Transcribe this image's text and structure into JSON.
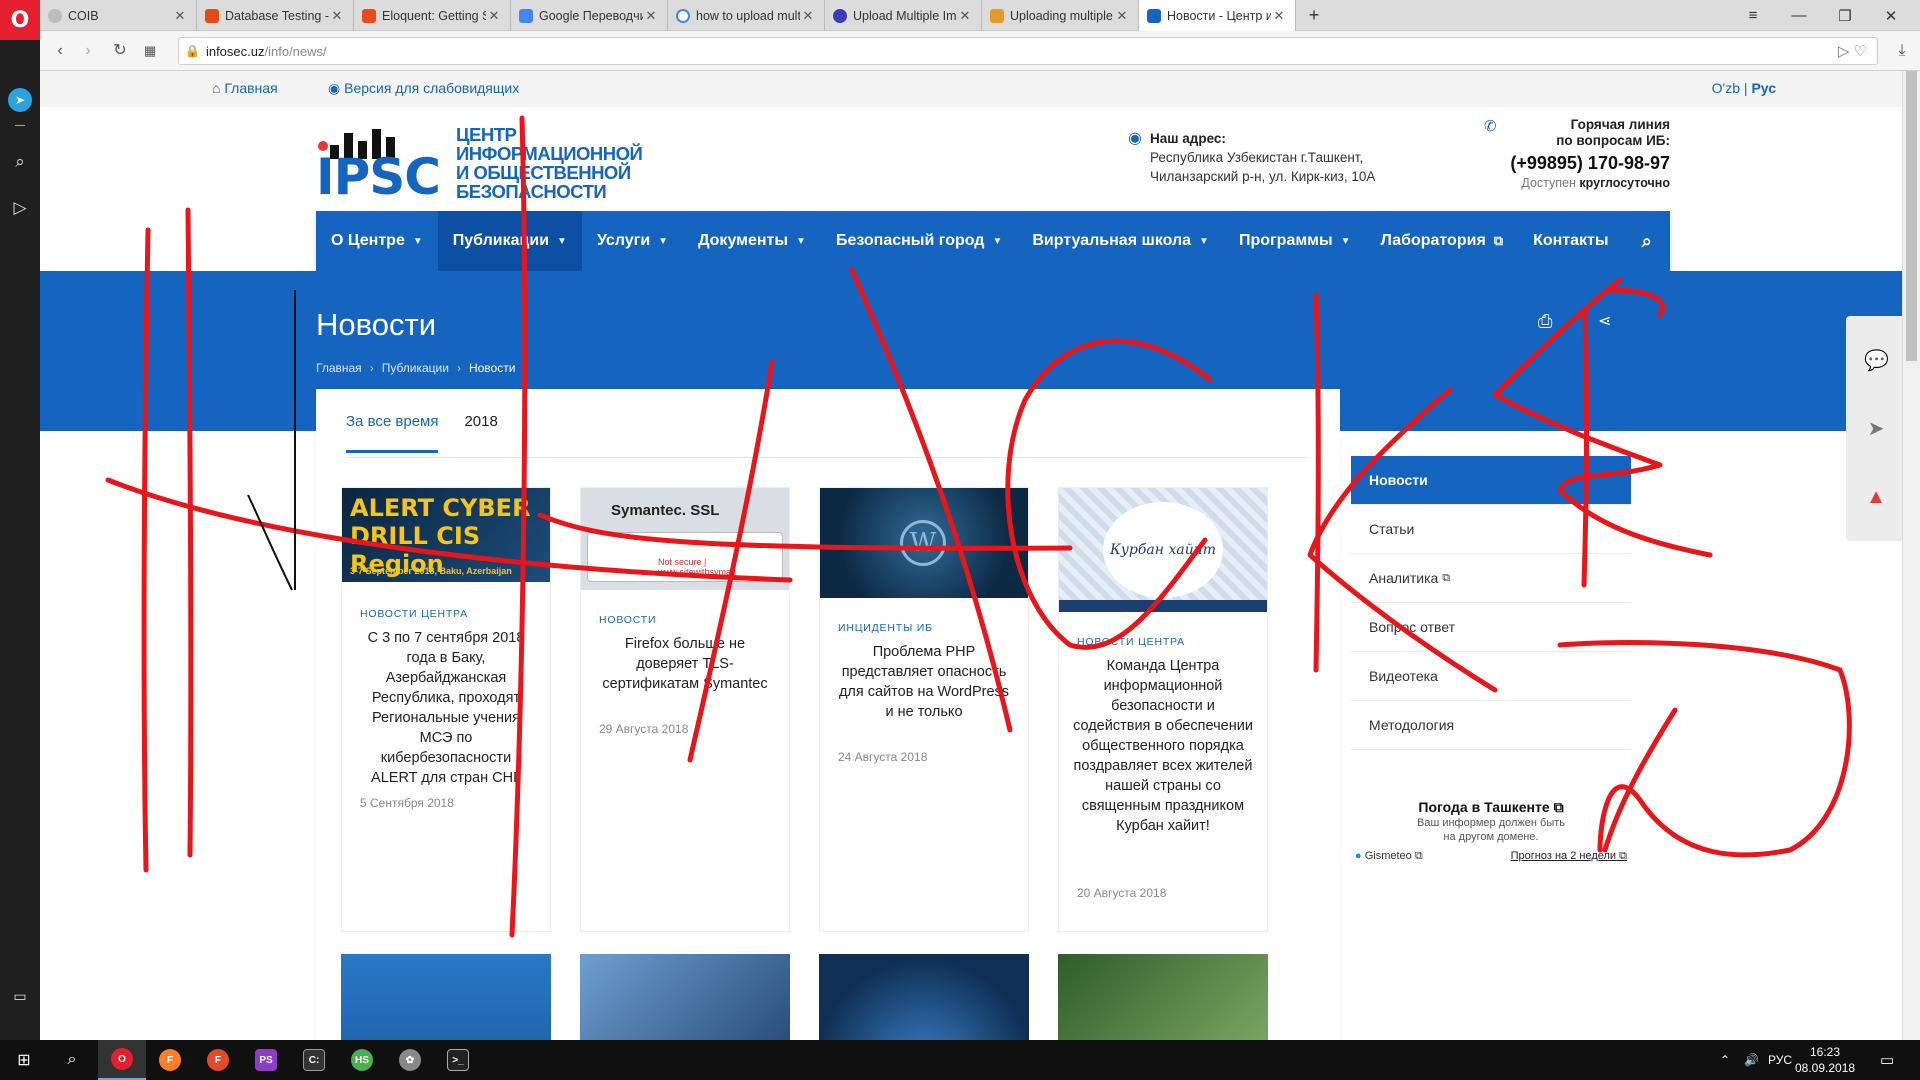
{
  "browser": {
    "tabs": [
      {
        "title": "COIB",
        "color": "#9e9e9e"
      },
      {
        "title": "Database Testing - Laravel",
        "color": "#e64a19"
      },
      {
        "title": "Eloquent: Getting Started",
        "color": "#e64a19"
      },
      {
        "title": "Google Переводчик",
        "color": "#4285f4"
      },
      {
        "title": "how to upload multiple file",
        "color": "#4285f4"
      },
      {
        "title": "Upload Multiple Images a",
        "color": "#3b3db8"
      },
      {
        "title": "Uploading multiple files in",
        "color": "#e69a2e"
      },
      {
        "title": "Новости - Центр информ",
        "color": "#1565c0"
      }
    ],
    "new_tab": "+",
    "url_host": "infosec.uz",
    "url_path": "/info/news/"
  },
  "topline": {
    "home": "Главная",
    "low_vision": "Версия для слабовидящих",
    "lang_uz": "O'zb",
    "lang_sep": "|",
    "lang_ru": "Рус"
  },
  "logo": {
    "abbr": "IPSC",
    "line1": "ЦЕНТР",
    "line2": "ИНФОРМАЦИОННОЙ",
    "line3": "И ОБЩЕСТВЕННОЙ",
    "line4": "БЕЗОПАСНОСТИ"
  },
  "address": {
    "title": "Наш адрес:",
    "line1": "Республика Узбекистан г.Ташкент,",
    "line2": "Чиланзарский р-н, ул. Кирк-киз, 10А"
  },
  "hotline": {
    "title1": "Горячая линия",
    "title2": "по вопросам ИБ:",
    "phone": "(+99895) 170-98-97",
    "note_prefix": "Доступен",
    "note_bold": "круглосуточно"
  },
  "nav": [
    {
      "label": "О Центре",
      "caret": true
    },
    {
      "label": "Публикации",
      "caret": true
    },
    {
      "label": "Услуги",
      "caret": true
    },
    {
      "label": "Документы",
      "caret": true
    },
    {
      "label": "Безопасный город",
      "caret": true
    },
    {
      "label": "Виртуальная школа",
      "caret": true
    },
    {
      "label": "Программы",
      "caret": true
    },
    {
      "label": "Лаборатория",
      "caret": false
    },
    {
      "label": "Контакты",
      "caret": false
    }
  ],
  "hero": {
    "title": "Новости",
    "crumbs": [
      "Главная",
      "Публикации",
      "Новости"
    ]
  },
  "filters": [
    "За все время",
    "2018"
  ],
  "news": [
    {
      "category": "НОВОСТИ ЦЕНТРА",
      "title": "С 3 по 7 сентября 2018 года в Баку, Азербайджанская Республика, проходят Региональные учения МСЭ по кибербезопасности ALERT для стран СНГ",
      "date": "5 Сентября 2018",
      "thumb_text": "ALERT CYBER DRILL CIS Region",
      "thumb_sub": "3-7 September 2018, Baku, Azerbaijan"
    },
    {
      "category": "НОВОСТИ",
      "title": "Firefox больше не доверяет TLS-сертификатам Symantec",
      "date": "29 Августа 2018",
      "thumb_text": "Symantec. SSL",
      "thumb_sub": "Not secure | www.sitewithsyman"
    },
    {
      "category": "ИНЦИДЕНТЫ ИБ",
      "title": "Проблема PHP представляет опасность для сайтов на WordPress и не только",
      "date": "24 Августа 2018"
    },
    {
      "category": "НОВОСТИ ЦЕНТРА",
      "title": "Команда Центра информационной безопасности и содействия в обеспечении общественного порядка поздравляет всех жителей нашей страны со священным праздником Курбан хайит!",
      "date": "20 Августа 2018",
      "thumb_text": "Курбан хайит"
    }
  ],
  "sidebar_nav": [
    {
      "label": "Новости",
      "active": true,
      "external": false
    },
    {
      "label": "Статьи",
      "active": false,
      "external": false
    },
    {
      "label": "Аналитика",
      "active": false,
      "external": true
    },
    {
      "label": "Вопрос ответ",
      "active": false,
      "external": false
    },
    {
      "label": "Видеотека",
      "active": false,
      "external": false
    },
    {
      "label": "Методология",
      "active": false,
      "external": false
    }
  ],
  "weather": {
    "title": "Погода в Ташкенте",
    "msg1": "Ваш информер должен быть",
    "msg2": "на другом домене.",
    "source": "Gismeteo",
    "forecast": "Прогноз на 2 недели"
  },
  "taskbar": {
    "lang": "РУС",
    "time": "16:23",
    "date": "08.09.2018"
  },
  "colors": {
    "brand_blue": "#1565c0",
    "scribble_red": "#e8161b"
  }
}
